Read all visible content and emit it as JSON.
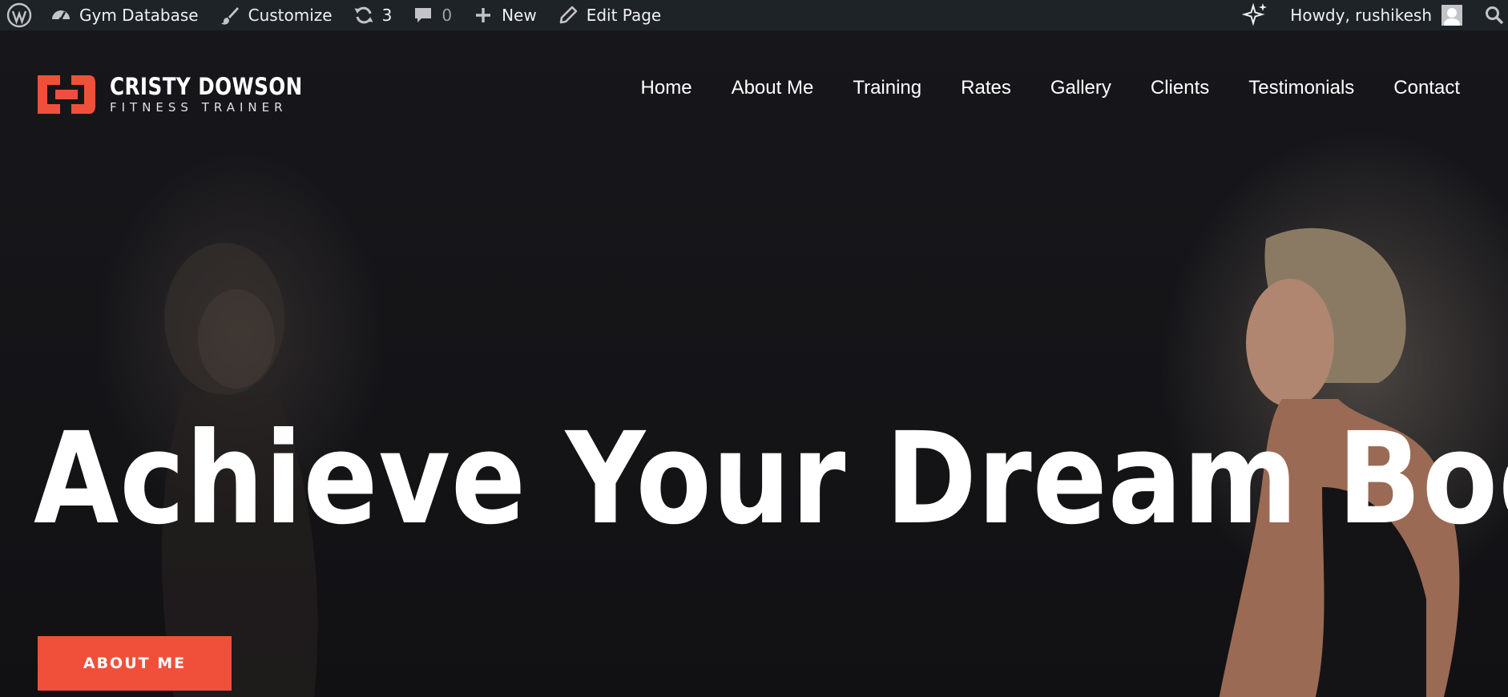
{
  "admin_bar": {
    "site_name": "Gym Database",
    "customize": "Customize",
    "updates_count": "3",
    "comments_count": "0",
    "new_label": "New",
    "edit_page": "Edit Page",
    "greeting": "Howdy, rushikesh"
  },
  "header": {
    "logo_name": "CRISTY DOWSON",
    "logo_tagline": "FITNESS TRAINER",
    "logo_accent": "#f0503a",
    "nav": [
      "Home",
      "About Me",
      "Training",
      "Rates",
      "Gallery",
      "Clients",
      "Testimonials",
      "Contact"
    ]
  },
  "hero": {
    "headline": "Achieve Your Dream Body",
    "cta_label": "ABOUT ME",
    "cta_color": "#f0503a"
  }
}
